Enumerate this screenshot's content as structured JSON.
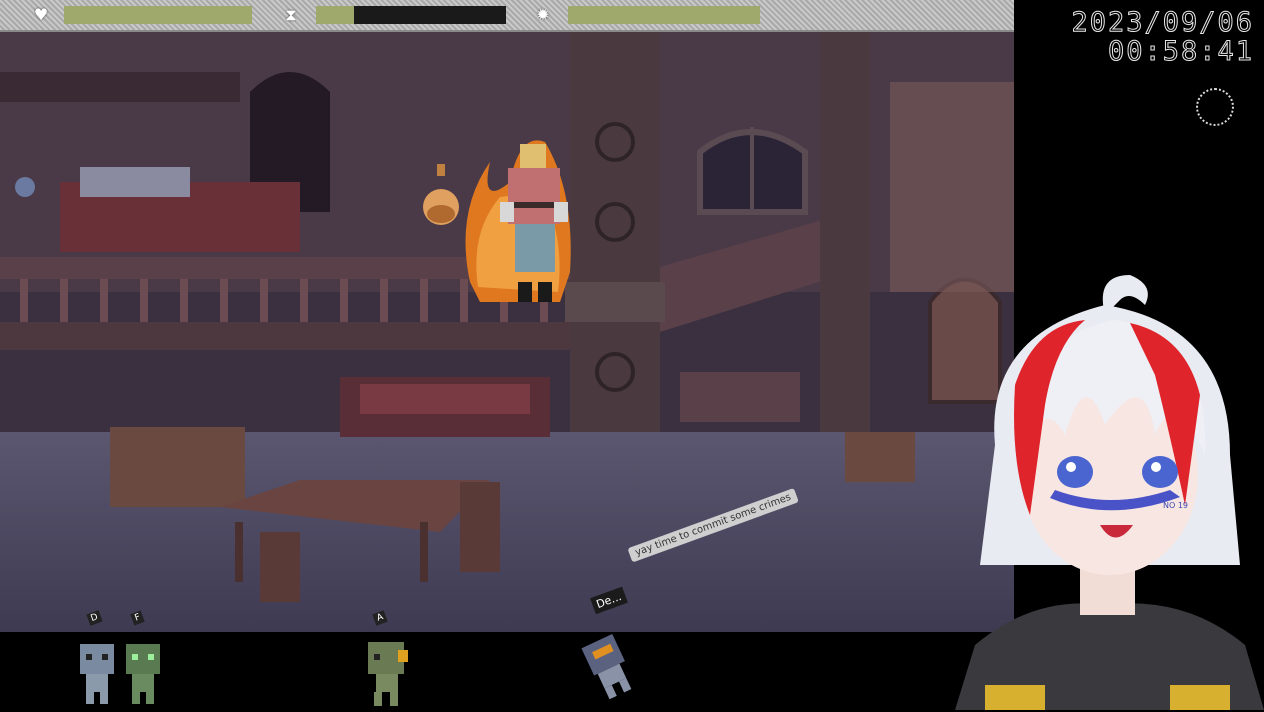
{
  "clock": {
    "date": "2023/09/06",
    "time": "00:58:41"
  },
  "hud": {
    "heart_icon": "heart-icon",
    "hourglass_icon": "hourglass-icon",
    "sun_icon": "sun-icon",
    "health_fraction": 1.0,
    "time_fraction": 0.2,
    "light_fraction": 1.0,
    "bar_color": "#9fa96b"
  },
  "scene": {
    "item": "potion-flask",
    "character": "player-on-fire"
  },
  "chat": {
    "username": "De...",
    "message": "yay time to commit some crimes"
  },
  "viewers": [
    {
      "tag": "D"
    },
    {
      "tag": "F"
    },
    {
      "tag": "A"
    },
    {
      "tag": ""
    }
  ],
  "avatar": {
    "face_text": "NO 19"
  }
}
